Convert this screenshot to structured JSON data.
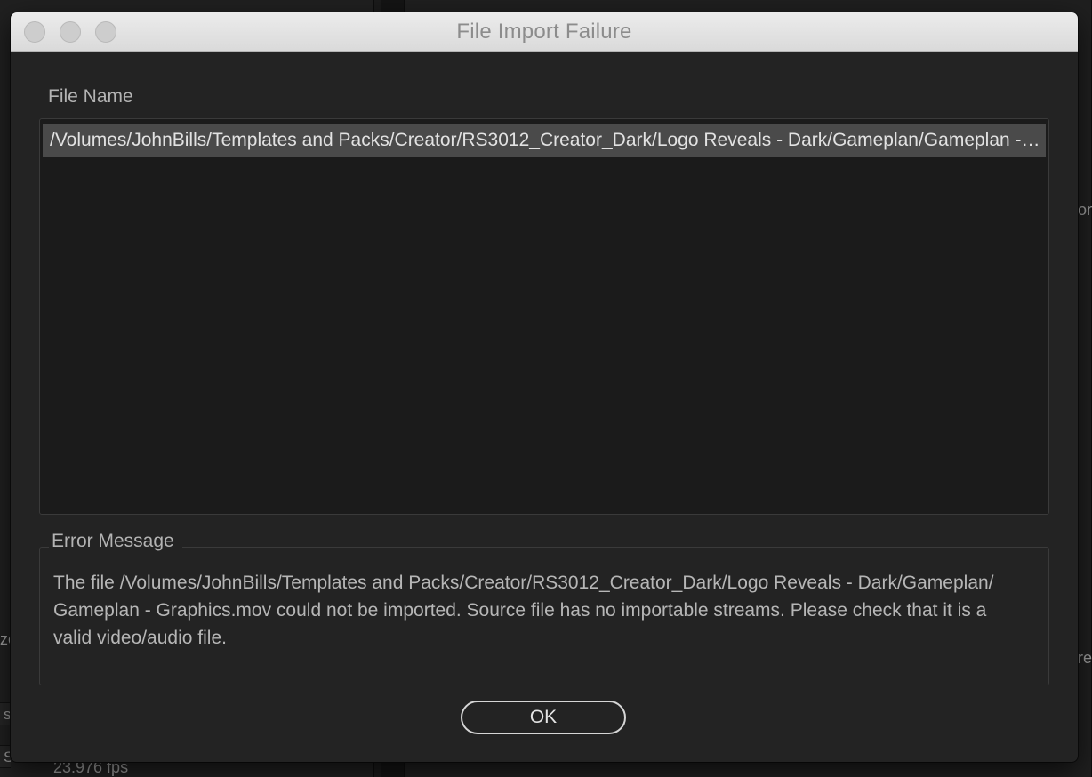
{
  "background": {
    "left_fragments": [
      "ze",
      "s",
      "S..."
    ],
    "right_fragments": [
      "on",
      "re"
    ],
    "bottom_fragment": "23.976 fps"
  },
  "dialog": {
    "title": "File Import Failure",
    "file_section": {
      "label": "File Name",
      "files": [
        "/Volumes/JohnBills/Templates and Packs/Creator/RS3012_Creator_Dark/Logo Reveals - Dark/Gameplan/Gameplan - Graphics.mov"
      ]
    },
    "error_section": {
      "label": "Error Message",
      "message": "The file /Volumes/JohnBills/Templates and Packs/Creator/RS3012_Creator_Dark/Logo Reveals - Dark/Gameplan/ Gameplan - Graphics.mov could not be imported. Source file has no importable streams. Please check that it is a valid video/audio file."
    },
    "ok_label": "OK"
  },
  "colors": {
    "dialog_bg": "#232323",
    "titlebar_bg": "#e3e3e3",
    "selected_row_bg": "#4a4a4a"
  }
}
